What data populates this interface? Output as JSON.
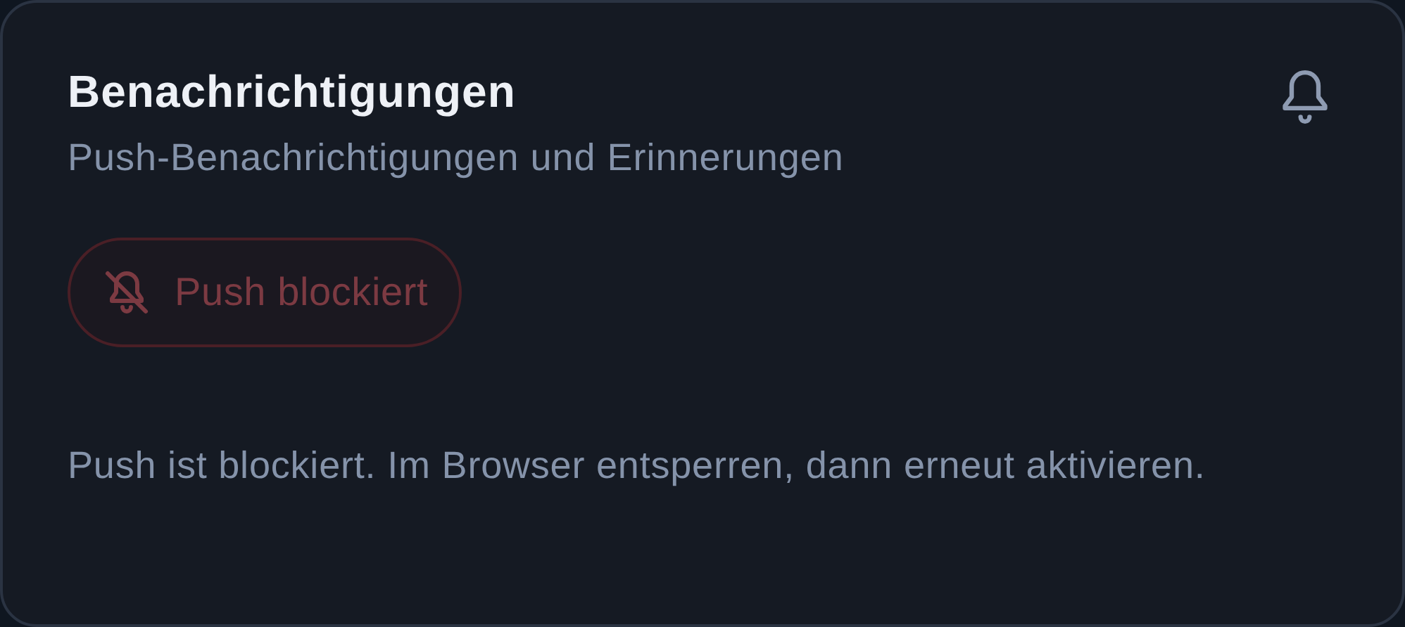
{
  "card": {
    "title": "Benachrichtigungen",
    "subtitle": "Push-Benachrichtigungen und Erinnerungen",
    "status_button": {
      "label": "Push blockiert",
      "disabled": true
    },
    "message": "Push ist blockiert. Im Browser entsperren, dann erneut aktivieren."
  }
}
